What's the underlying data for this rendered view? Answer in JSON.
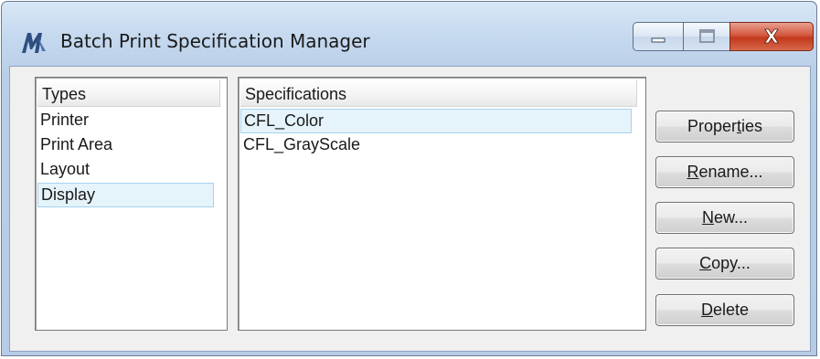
{
  "window": {
    "title": "Batch Print Specification Manager",
    "icon": "bentley-m-icon"
  },
  "caption_buttons": {
    "minimize_icon": "minimize-icon",
    "maximize_icon": "maximize-icon",
    "close_label": "X"
  },
  "types_list": {
    "header": "Types",
    "items": [
      "Printer",
      "Print Area",
      "Layout",
      "Display"
    ],
    "selected": "Display"
  },
  "specifications_list": {
    "header": "Specifications",
    "items": [
      "CFL_Color",
      "CFL_GrayScale"
    ],
    "selected": "CFL_Color"
  },
  "buttons": {
    "properties": {
      "pre": "Proper",
      "key": "t",
      "post": "ies"
    },
    "rename": {
      "pre": "",
      "key": "R",
      "post": "ename..."
    },
    "new": {
      "pre": "",
      "key": "N",
      "post": "ew..."
    },
    "copy": {
      "pre": "",
      "key": "C",
      "post": "opy..."
    },
    "delete": {
      "pre": "",
      "key": "D",
      "post": "elete"
    }
  },
  "colors": {
    "title_gradient_top": "#d8e7f6",
    "selection_bg": "#e5f3fb",
    "selection_border": "#a6d3ef",
    "close_button": "#c2391c",
    "icon_color": "#3a5a86"
  }
}
